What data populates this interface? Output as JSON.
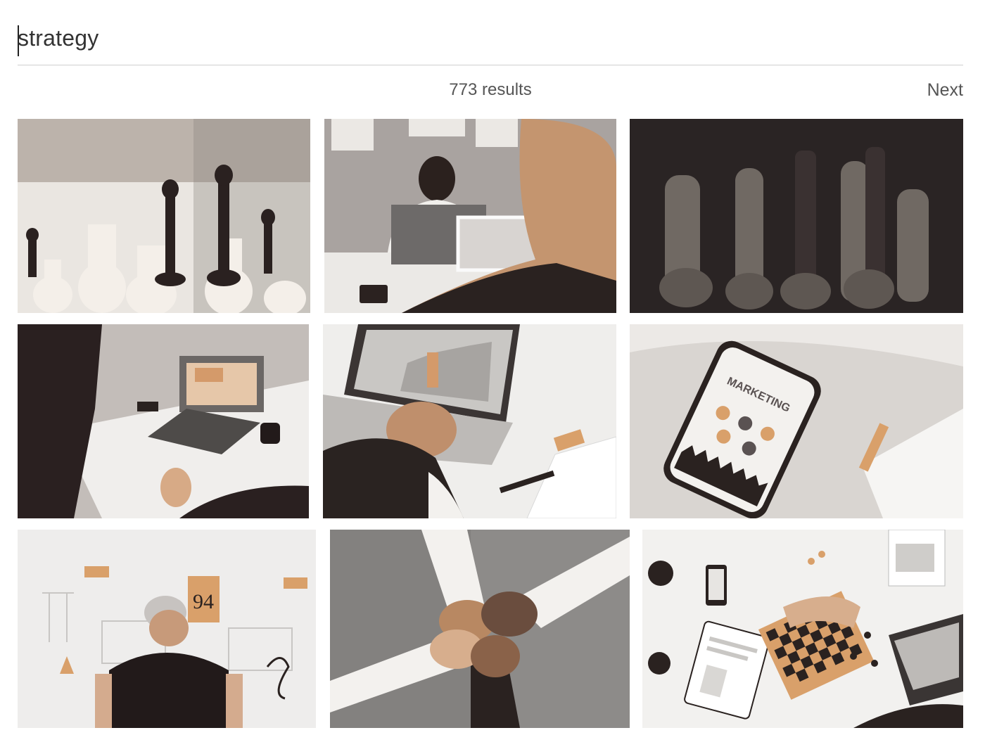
{
  "search": {
    "query": "strategy",
    "placeholder": ""
  },
  "results": {
    "count_label": "773 results",
    "next_label": "Next"
  },
  "images": [
    {
      "subject": "chess pieces close-up, light background"
    },
    {
      "subject": "man working at laptop in office"
    },
    {
      "subject": "dark chess pieces silhouettes"
    },
    {
      "subject": "team meeting with laptops"
    },
    {
      "subject": "hands typing on laptop with clipboard"
    },
    {
      "subject": "phone showing marketing app",
      "screen_text": "MARKETING"
    },
    {
      "subject": "man in cap in front of whiteboard",
      "board_text": "94"
    },
    {
      "subject": "hands joined together from above"
    },
    {
      "subject": "overhead desk with chessboard and laptops"
    }
  ],
  "colors": {
    "accent": "#d9a06a",
    "dark": "#251c1c",
    "divider": "#cfcfcf"
  }
}
